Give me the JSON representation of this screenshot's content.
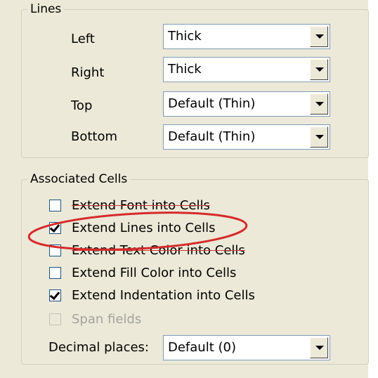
{
  "lines": {
    "title": "Lines",
    "rows": [
      {
        "label": "Left",
        "value": "Thick"
      },
      {
        "label": "Right",
        "value": "Thick"
      },
      {
        "label": "Top",
        "value": "Default (Thin)"
      },
      {
        "label": "Bottom",
        "value": "Default (Thin)"
      }
    ]
  },
  "associated": {
    "title": "Associated Cells",
    "options": [
      {
        "label": "Extend Font into Cells",
        "checked": false,
        "enabled": true
      },
      {
        "label": "Extend Lines into Cells",
        "checked": true,
        "enabled": true
      },
      {
        "label": "Extend Text Color into Cells",
        "checked": false,
        "enabled": true
      },
      {
        "label": "Extend Fill Color into Cells",
        "checked": false,
        "enabled": true
      },
      {
        "label": "Extend Indentation into Cells",
        "checked": true,
        "enabled": true
      },
      {
        "label": "Span fields",
        "checked": false,
        "enabled": false
      }
    ],
    "decimal_label": "Decimal places:",
    "decimal_value": "Default  (0)"
  },
  "colors": {
    "panel": "#ece9d8",
    "highlight": "#d62b2b",
    "border": "#7f9db9"
  }
}
